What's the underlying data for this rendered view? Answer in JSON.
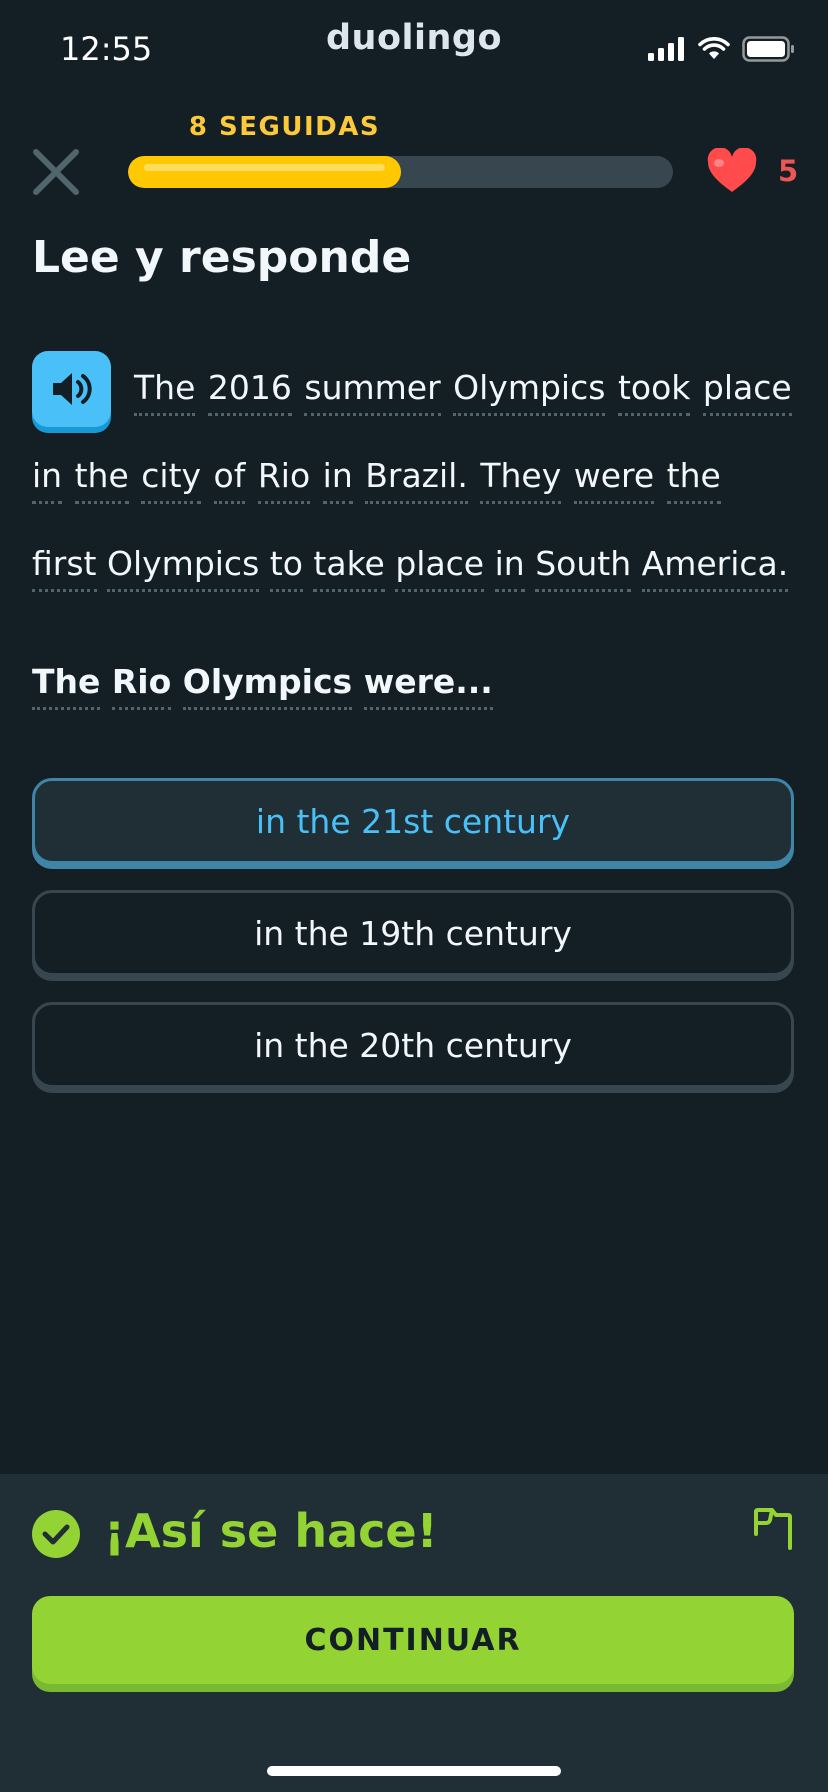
{
  "status_bar": {
    "time": "12:55",
    "brand": "duolingo",
    "icons": [
      "signal-icon",
      "wifi-icon",
      "battery-icon"
    ]
  },
  "header": {
    "close_icon": "close-icon",
    "streak_label": "8 SEGUIDAS",
    "progress_fraction": 0.5,
    "hearts_icon": "heart-icon",
    "hearts_count": "5"
  },
  "exercise": {
    "title": "Lee y responde",
    "audio_icon": "speaker-icon",
    "passage_lines": [
      [
        "The",
        "2016",
        "summer",
        "Olympics",
        "took",
        "place"
      ],
      [
        "in",
        "the",
        "city",
        "of",
        "Rio",
        "in",
        "Brazil.",
        "They",
        "were",
        "the"
      ],
      [
        "first",
        "Olympics",
        "to",
        "take",
        "place",
        "in",
        "South",
        "America."
      ]
    ],
    "question_words": [
      "The",
      "Rio",
      "Olympics",
      "were..."
    ],
    "options": [
      {
        "label": "in the 21st century",
        "selected": true
      },
      {
        "label": "in the 19th century",
        "selected": false
      },
      {
        "label": "in the 20th century",
        "selected": false
      }
    ]
  },
  "feedback": {
    "check_icon": "check-circle-icon",
    "message": "¡Así se hace!",
    "flag_icon": "flag-icon",
    "continue_label": "CONTINUAR"
  },
  "colors": {
    "background": "#131f24",
    "accent_blue": "#49c0f8",
    "success_green": "#93d333",
    "streak_yellow": "#ffc800",
    "heart_red": "#ee5555"
  }
}
